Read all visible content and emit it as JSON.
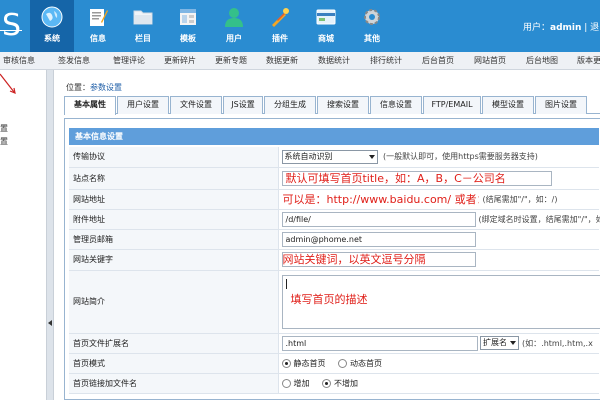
{
  "header": {
    "logo_text": "S",
    "nav": [
      {
        "label": "系统",
        "icon": "globe-icon",
        "active": true
      },
      {
        "label": "信息",
        "icon": "document-edit-icon",
        "active": false
      },
      {
        "label": "栏目",
        "icon": "folder-icon",
        "active": false
      },
      {
        "label": "模板",
        "icon": "template-icon",
        "active": false
      },
      {
        "label": "用户",
        "icon": "user-icon",
        "active": false
      },
      {
        "label": "插件",
        "icon": "plugin-tools-icon",
        "active": false
      },
      {
        "label": "商城",
        "icon": "shop-card-icon",
        "active": false
      },
      {
        "label": "其他",
        "icon": "gear-icon",
        "active": false
      }
    ],
    "user_prefix": "用户：",
    "username": "admin",
    "user_suffix": " | 退"
  },
  "submenu": [
    "审核信息",
    "签发信息",
    "管理评论",
    "更新碎片",
    "更新专题",
    "数据更新",
    "数据统计",
    "排行统计",
    "后台首页",
    "网站首页",
    "后台地图",
    "版本更"
  ],
  "sidebar": {
    "items": [
      "置",
      "置"
    ]
  },
  "breadcrumb": {
    "prefix": "位置：",
    "link": "参数设置"
  },
  "tabs": [
    "基本属性",
    "用户设置",
    "文件设置",
    "JS设置",
    "分组生成",
    "搜索设置",
    "信息设置",
    "FTP/EMAIL",
    "模型设置",
    "图片设置"
  ],
  "panel_title": "基本信息设置",
  "form": {
    "protocol": {
      "label": "传输协议",
      "value": "系统自动识别",
      "hint": "(一般默认即可，使用https需要服务器支持)"
    },
    "site_name": {
      "label": "站点名称",
      "annotation": "默认可填写首页title，如：A，B，C－公司名"
    },
    "site_url": {
      "label": "网站地址",
      "annotation": "可以是：http://www.baidu.com/  或者：/",
      "hint": "(结尾需加\"/\"，如：/)"
    },
    "attach_url": {
      "label": "附件地址",
      "value": "/d/file/",
      "hint": "(绑定域名时设置，结尾需加\"/\"，如：/d/"
    },
    "admin_email": {
      "label": "管理员邮箱",
      "value": "admin@phome.net"
    },
    "keywords": {
      "label": "网站关键字",
      "annotation": "网站关键词，以英文逗号分隔"
    },
    "description": {
      "label": "网站简介",
      "annotation": "填写首页的描述"
    },
    "ext": {
      "label": "首页文件扩展名",
      "value": ".html",
      "select": "扩展名",
      "hint": "(如：.html,.htm,.x"
    },
    "mode": {
      "label": "首页模式",
      "options": [
        "静态首页",
        "动态首页"
      ],
      "selected": 0
    },
    "link_file": {
      "label": "首页链接加文件名",
      "options": [
        "增加",
        "不增加"
      ],
      "selected": 1
    }
  }
}
